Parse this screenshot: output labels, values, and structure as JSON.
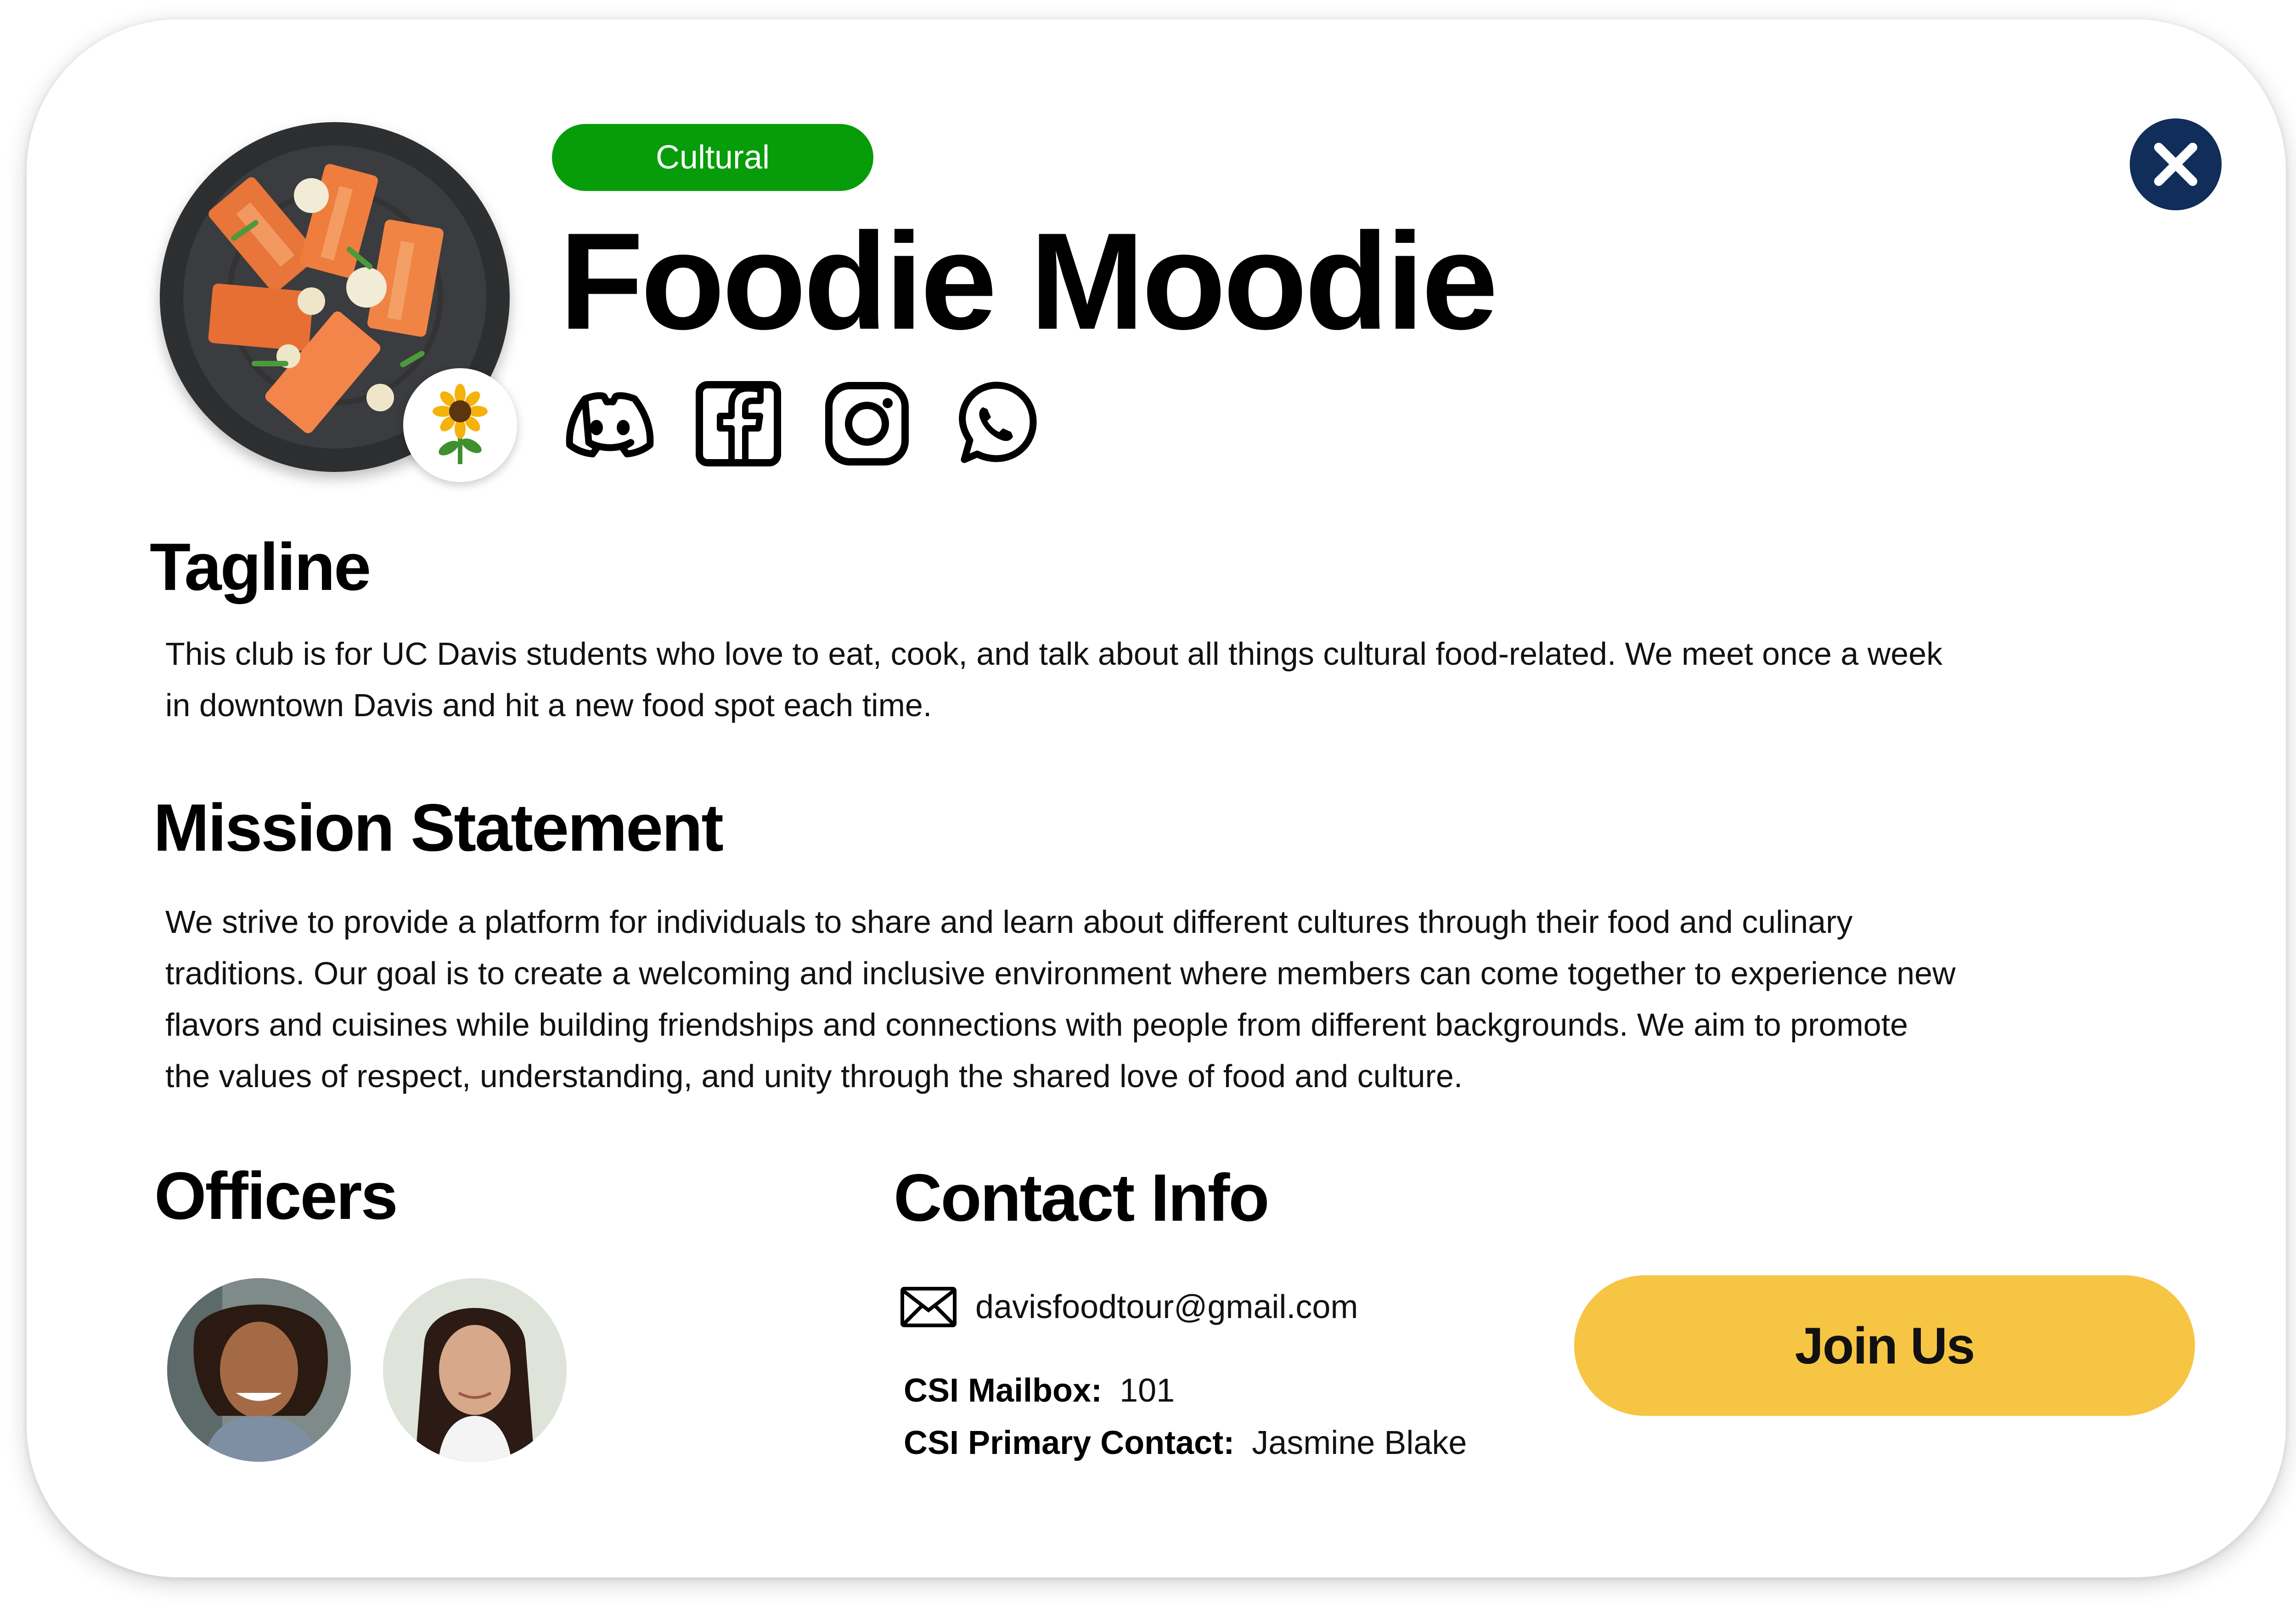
{
  "club": {
    "name": "Foodie Moodie",
    "category": "Cultural",
    "emoji": "🌻",
    "logo_icon": "food-platter-icon"
  },
  "socials": [
    "discord-icon",
    "facebook-icon",
    "instagram-icon",
    "whatsapp-icon"
  ],
  "tagline": {
    "heading": "Tagline",
    "lines": [
      "This club is for UC Davis students who love to eat, cook, and talk about all things cultural food-related. We meet once a week",
      "in downtown Davis and hit a new food spot each time."
    ]
  },
  "mission": {
    "heading": "Mission Statement",
    "lines": [
      "We strive to provide a platform for individuals to share and learn about different cultures through their food and culinary",
      "traditions. Our goal is to create a welcoming and inclusive environment where members can come together to experience new",
      "flavors and cuisines while building friendships and connections with people from different backgrounds. We aim to promote",
      "the values of respect, understanding, and unity through the shared love of food and culture."
    ]
  },
  "officers": {
    "heading": "Officers"
  },
  "contact": {
    "heading": "Contact Info",
    "email": "davisfoodtour@gmail.com",
    "mailbox_label": "CSI Mailbox:",
    "mailbox_value": "101",
    "primary_label": "CSI Primary Contact:",
    "primary_value": "Jasmine Blake"
  },
  "actions": {
    "join_label": "Join Us"
  },
  "colors": {
    "category_green": "#079d0a",
    "close_navy": "#112d5a",
    "join_yellow": "#f6c544"
  }
}
